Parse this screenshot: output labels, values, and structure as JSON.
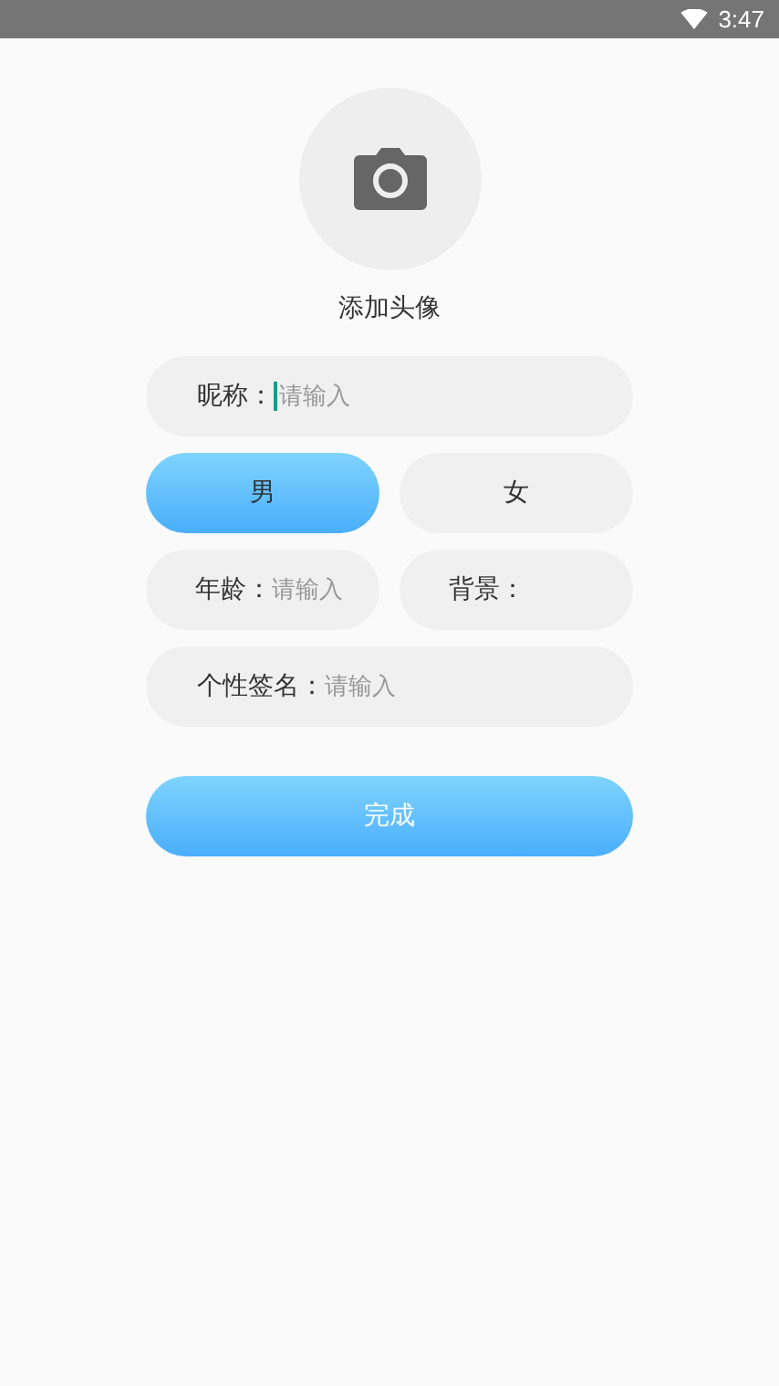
{
  "status_bar": {
    "time": "3:47"
  },
  "avatar": {
    "label": "添加头像"
  },
  "nickname": {
    "label": "昵称：",
    "placeholder": "请输入",
    "focused": true
  },
  "gender": [
    {
      "label": "男",
      "selected": true
    },
    {
      "label": "女",
      "selected": false
    }
  ],
  "age": {
    "label": "年龄：",
    "placeholder": "请输入"
  },
  "background": {
    "label": "背景："
  },
  "signature": {
    "label": "个性签名：",
    "placeholder": "请输入"
  },
  "submit": {
    "label": "完成"
  }
}
